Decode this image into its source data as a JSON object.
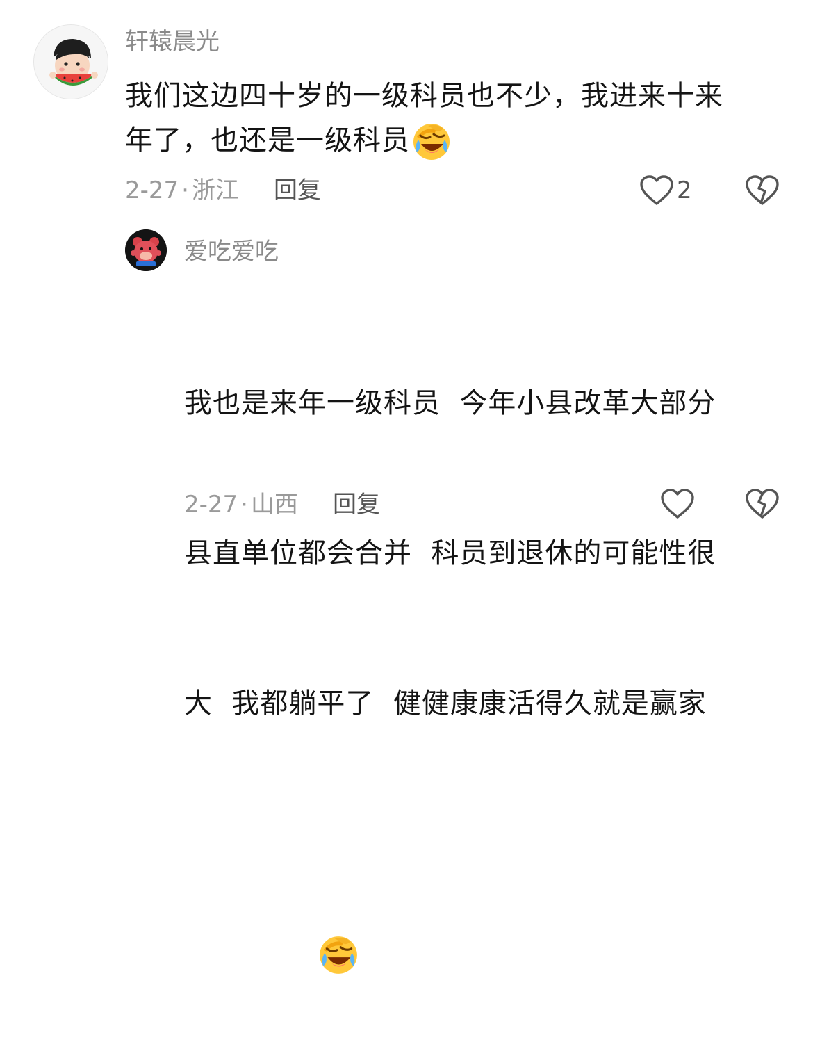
{
  "comments": [
    {
      "username": "轩辕晨光",
      "content_line1": "我们这边四十岁的一级科员也不少，我进来十来",
      "content_line2": "年了，也还是一级科员",
      "emoji": "laughing-crying-emoji",
      "date": "2-27",
      "location": "浙江",
      "reply_label": "回复",
      "like_count": "2"
    },
    {
      "username": "爱吃爱吃",
      "content_line1": "我也是来年一级科员  今年小县改革大部分",
      "content_line2": "县直单位都会合并  科员到退休的可能性很",
      "content_line3": "大  我都躺平了  健健康康活得久就是赢家",
      "emoji": "laughing-crying-emoji",
      "date": "2-27",
      "location": "山西",
      "reply_label": "回复"
    }
  ],
  "colors": {
    "username": "#8a8a8a",
    "text": "#141414",
    "meta": "#9a9a9a",
    "reply": "#555555",
    "emoji_yellow": "#FFC83A"
  }
}
